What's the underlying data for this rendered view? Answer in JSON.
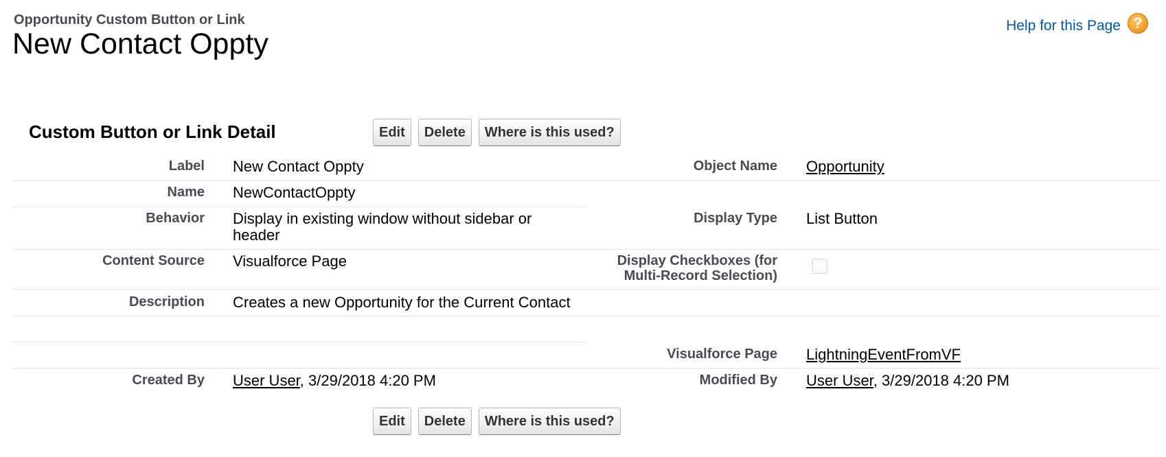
{
  "page": {
    "object_type": "Opportunity Custom Button or Link",
    "title": "New Contact Oppty",
    "help_link": "Help for this Page",
    "help_icon": "help-question-icon"
  },
  "detail": {
    "section_title": "Custom Button or Link Detail",
    "buttons": {
      "edit": "Edit",
      "delete": "Delete",
      "where_used": "Where is this used?"
    },
    "fields": {
      "label_label": "Label",
      "label_value": "New Contact Oppty",
      "object_name_label": "Object Name",
      "object_name_value": "Opportunity",
      "name_label": "Name",
      "name_value": "NewContactOppty",
      "behavior_label": "Behavior",
      "behavior_value_line1": "Display in existing window without sidebar or",
      "behavior_value_line2": "header",
      "display_type_label": "Display Type",
      "display_type_value": "List Button",
      "content_source_label": "Content Source",
      "content_source_value": "Visualforce Page",
      "display_checkboxes_label_line1": "Display Checkboxes (for",
      "display_checkboxes_label_line2": "Multi-Record Selection)",
      "display_checkboxes_checked": false,
      "description_label": "Description",
      "description_value": "Creates a new Opportunity for the Current Contact",
      "visualforce_page_label": "Visualforce Page",
      "visualforce_page_value": "LightningEventFromVF",
      "created_by_label": "Created By",
      "created_by_user": "User User",
      "created_by_date": ", 3/29/2018 4:20 PM",
      "modified_by_label": "Modified By",
      "modified_by_user": "User User",
      "modified_by_date": ", 3/29/2018 4:20 PM"
    }
  }
}
